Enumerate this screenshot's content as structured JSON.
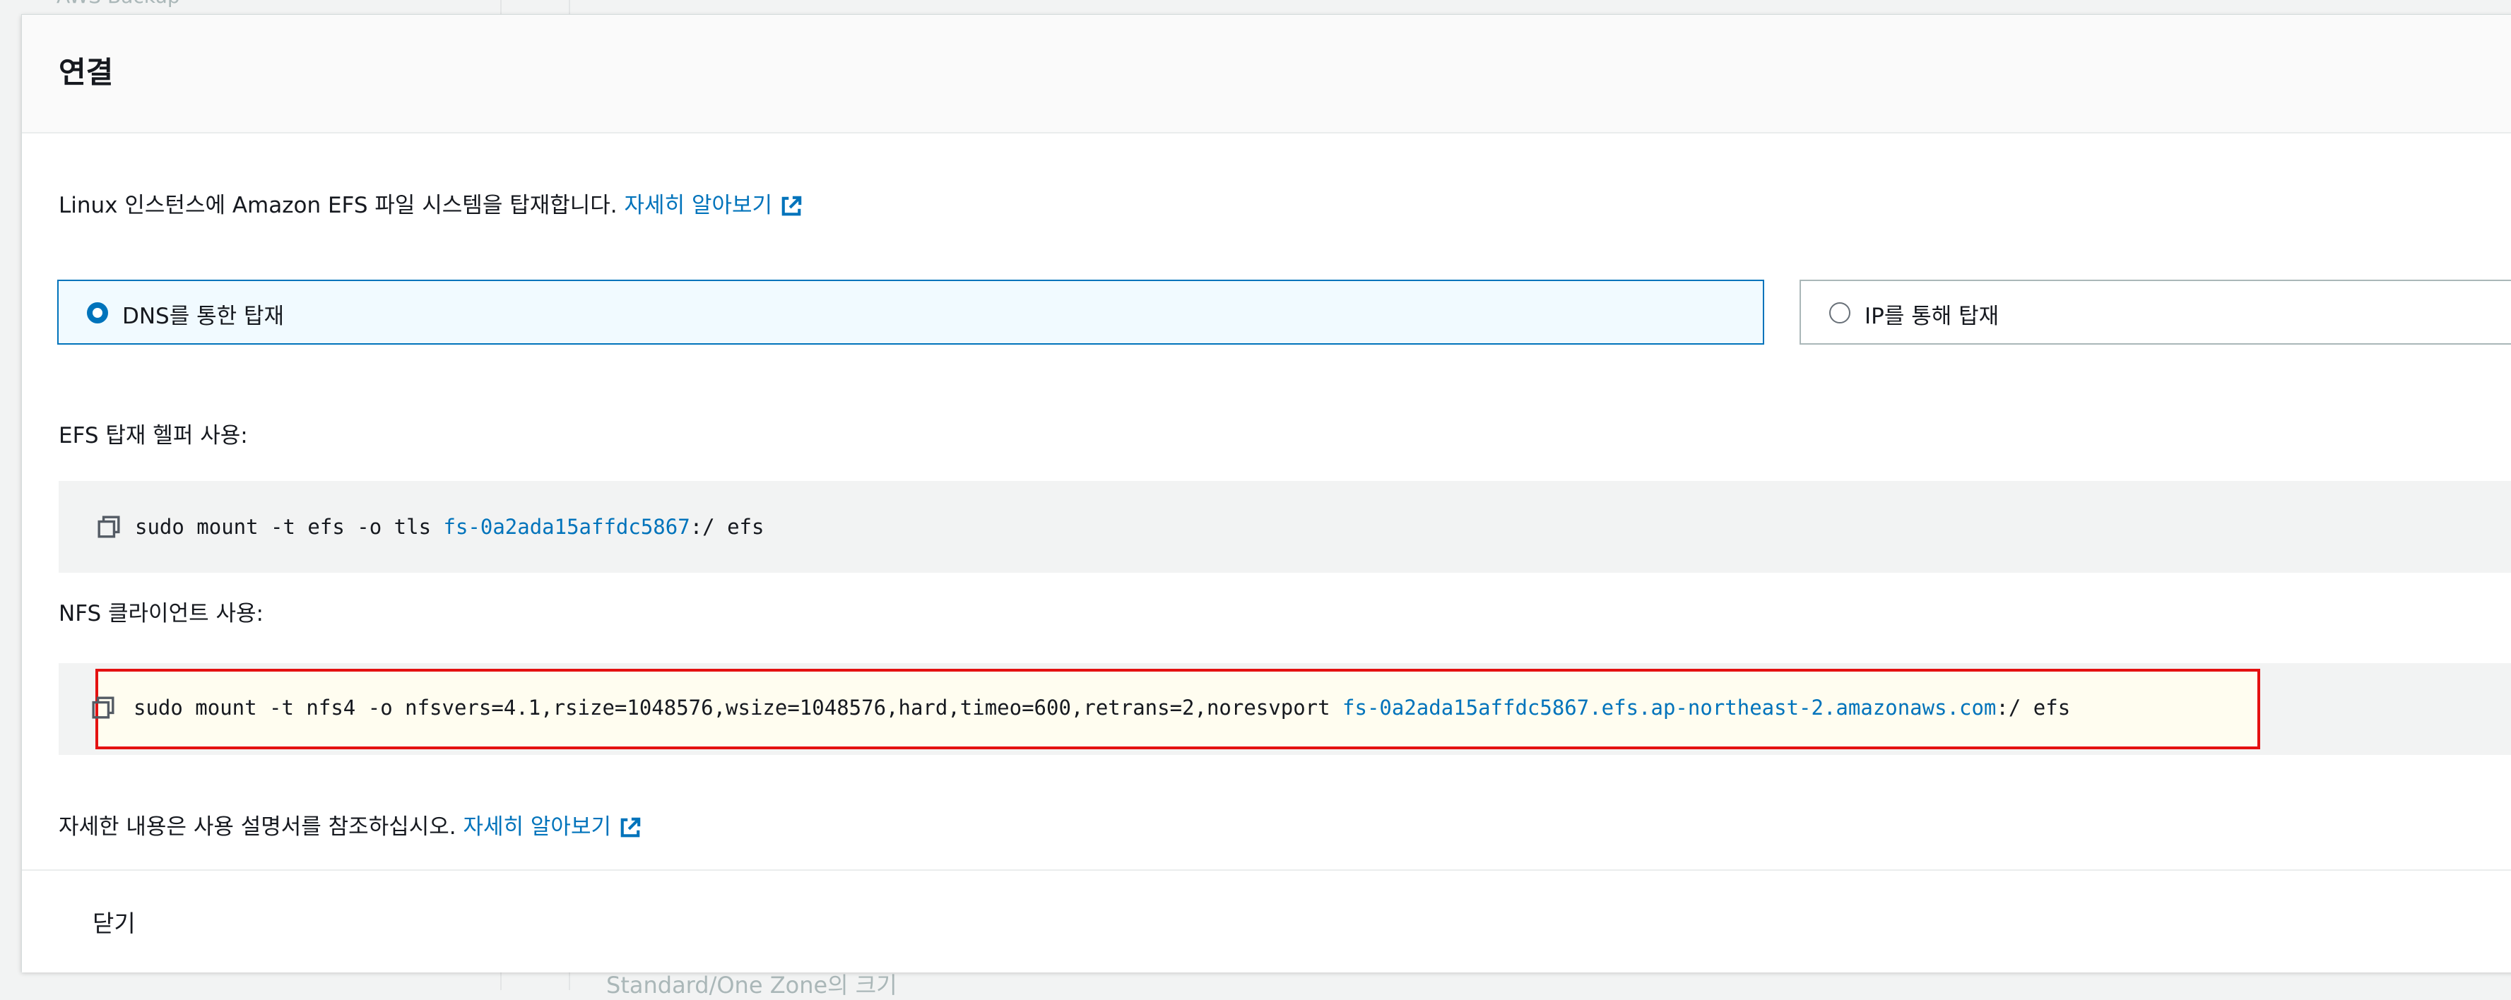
{
  "background": {
    "top_text": "AWS Backup",
    "bottom_text": "Standard/One Zone의 크기"
  },
  "modal": {
    "title": "연결",
    "intro_text": "Linux 인스턴스에 Amazon EFS 파일 시스템을 탑재합니다.",
    "intro_link": "자세히 알아보기",
    "options": {
      "dns": {
        "label": "DNS를 통한 탑재",
        "selected": true
      },
      "ip": {
        "label": "IP를 통해 탑재",
        "selected": false
      }
    },
    "efs_helper": {
      "label": "EFS 탑재 헬퍼 사용:",
      "cmd_prefix": "sudo mount -t efs -o tls ",
      "cmd_target": "fs-0a2ada15affdc5867",
      "cmd_suffix": ":/ efs"
    },
    "nfs_client": {
      "label": "NFS 클라이언트 사용:",
      "cmd_prefix": "sudo mount -t nfs4 -o nfsvers=4.1,rsize=1048576,wsize=1048576,hard,timeo=600,retrans=2,noresvport ",
      "cmd_target": "fs-0a2ada15affdc5867.efs.ap-northeast-2.amazonaws.com",
      "cmd_suffix": ":/ efs"
    },
    "footer_text": "자세한 내용은 사용 설명서를 참조하십시오.",
    "footer_link": "자세히 알아보기",
    "close_label": "닫기"
  },
  "colors": {
    "link": "#0073bb",
    "highlight_border": "#e41111",
    "selected_tile_bg": "#f1faff"
  },
  "icons": {
    "copy": "copy-icon",
    "external": "external-link-icon"
  }
}
